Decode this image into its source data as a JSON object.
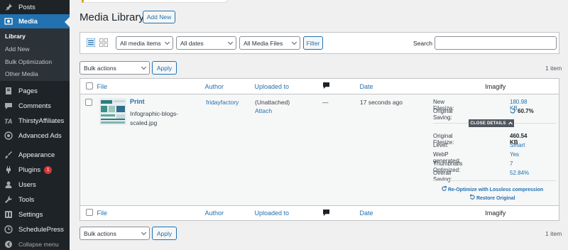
{
  "sidebar": {
    "items": [
      {
        "label": "Posts",
        "icon": "pin-icon"
      },
      {
        "label": "Media",
        "icon": "media-icon"
      },
      {
        "label": "Pages",
        "icon": "pages-icon"
      },
      {
        "label": "Comments",
        "icon": "comments-icon"
      },
      {
        "label": "ThirstyAffiliates",
        "icon": "ta-icon"
      },
      {
        "label": "Advanced Ads",
        "icon": "ads-icon"
      },
      {
        "label": "Appearance",
        "icon": "brush-icon"
      },
      {
        "label": "Plugins",
        "icon": "plugin-icon",
        "badge": "1"
      },
      {
        "label": "Users",
        "icon": "users-icon"
      },
      {
        "label": "Tools",
        "icon": "wrench-icon"
      },
      {
        "label": "Settings",
        "icon": "settings-icon"
      },
      {
        "label": "SchedulePress",
        "icon": "schedule-icon"
      },
      {
        "label": "Collapse menu",
        "icon": "collapse-icon"
      }
    ],
    "submenu": [
      "Library",
      "Add New",
      "Bulk Optimization",
      "Other Media"
    ]
  },
  "page": {
    "title": "Media Library",
    "add_new": "Add New"
  },
  "filters": {
    "media_items": "All media items",
    "dates": "All dates",
    "media_files": "All Media Files",
    "filter_button": "Filter",
    "search_label": "Search"
  },
  "bulk": {
    "label": "Bulk actions",
    "apply": "Apply",
    "count": "1 item"
  },
  "columns": {
    "file": "File",
    "author": "Author",
    "uploaded_to": "Uploaded to",
    "date": "Date",
    "imagify": "Imagify"
  },
  "row": {
    "title": "Print",
    "filename": "Infographic-blogs-scaled.jpg",
    "author": "fridayfactory",
    "attached": "(Unattached)",
    "attach": "Attach",
    "comments": "—",
    "date": "17 seconds ago",
    "imagify": {
      "new_filesize_label": "New Filesize:",
      "new_filesize": "180.98 KB",
      "original_saving_label": "Original Saving:",
      "original_saving": "60.7%",
      "close_details": "CLOSE DETAILS",
      "original_filesize_label": "Original Filesize:",
      "original_filesize": "460.54 KB",
      "level_label": "Level:",
      "level": "Smart",
      "webp_label": "WebP generated:",
      "webp": "Yes",
      "thumbs_label": "Thumbnails Optimized:",
      "thumbs": "7",
      "overall_label": "Overall Saving:",
      "overall": "52.84%",
      "reoptimize": "Re-Optimize with Lossless compression",
      "restore": "Restore Original"
    }
  },
  "colors": {
    "sidebar": "#1d2327",
    "accent": "#2271b1",
    "badge": "#d63638"
  }
}
